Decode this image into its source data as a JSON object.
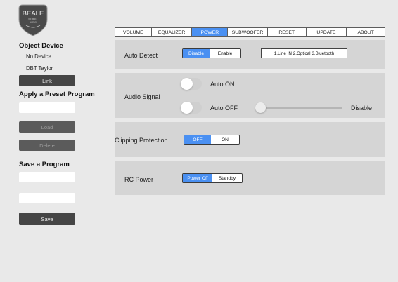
{
  "logo": {
    "line1": "BEALE",
    "line2": "STREET",
    "line3": "AUDIO"
  },
  "left": {
    "object_device_title": "Object Device",
    "device_lines": [
      "No Device",
      "DBT Taylor"
    ],
    "link_label": "Link",
    "preset_title": "Apply a Preset Program",
    "load_label": "Load",
    "delete_label": "Delete",
    "save_program_title": "Save a Program",
    "save_label": "Save"
  },
  "tabs": [
    "VOLUME",
    "EQUALIZER",
    "POWER",
    "SUBWOOFER",
    "RESET",
    "UPDATE",
    "ABOUT"
  ],
  "active_tab": "POWER",
  "auto_detect": {
    "label": "Auto Detect",
    "options": [
      "Disable",
      "Enable"
    ],
    "selected": "Disable",
    "info": "1.Line IN 2.Optical 3.Bluetooth"
  },
  "audio_signal": {
    "label": "Audio Signal",
    "auto_on_label": "Auto ON",
    "auto_on_state": false,
    "auto_off_label": "Auto OFF",
    "auto_off_state": false,
    "slider_value": "Disable"
  },
  "clipping": {
    "label": "Clipping Protection",
    "options": [
      "OFF",
      "ON"
    ],
    "selected": "OFF"
  },
  "rc_power": {
    "label": "RC Power",
    "options": [
      "Power Off",
      "Standby"
    ],
    "selected": "Power Off"
  },
  "colors": {
    "accent": "#4a90f2",
    "section_bg": "#d5d5d5",
    "page_bg": "#e9e9e9",
    "dark_button": "#454545"
  }
}
